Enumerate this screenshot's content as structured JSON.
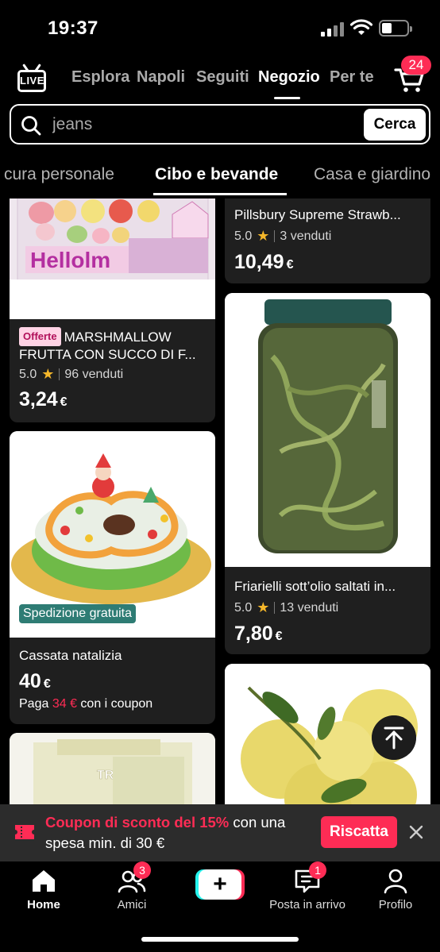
{
  "status_bar": {
    "time": "19:37"
  },
  "top_nav": {
    "live_label": "LIVE",
    "tabs": [
      {
        "label": "Esplora"
      },
      {
        "label": "Napoli"
      },
      {
        "label": "Seguiti"
      },
      {
        "label": "Negozio",
        "active": true
      },
      {
        "label": "Per te"
      }
    ],
    "cart_count": "24"
  },
  "search": {
    "value": "jeans",
    "button": "Cerca"
  },
  "categories": [
    {
      "label": "cura personale"
    },
    {
      "label": "Cibo e bevande",
      "active": true
    },
    {
      "label": "Casa e giardino"
    }
  ],
  "products": [
    {
      "badge": "Offerte",
      "title": "MARSHMALLOW FRUTTA CON SUCCO DI F...",
      "rating": "5.0",
      "sold": "96 venduti",
      "price": "3,24",
      "currency": "€",
      "image_text": "Hellolm"
    },
    {
      "title": "Pillsbury Supreme Strawb...",
      "rating": "5.0",
      "sold": "3 venduti",
      "price": "10,49",
      "currency": "€"
    },
    {
      "title": "Friarielli sott’olio saltati in...",
      "rating": "5.0",
      "sold": "13 venduti",
      "price": "7,80",
      "currency": "€"
    },
    {
      "shipping_tag": "Spedizione gratuita",
      "title": "Cassata natalizia",
      "price": "40",
      "currency": "€",
      "coupon_prefix": "Paga",
      "coupon_price": "34 €",
      "coupon_suffix": "con i coupon"
    },
    {
      "image_text": "TROIANO"
    },
    {
      "image_text": ""
    }
  ],
  "coupon_banner": {
    "highlight": "Coupon di sconto del 15%",
    "text": "con una spesa min. di 30 €",
    "button": "Riscatta"
  },
  "bottom_nav": [
    {
      "label": "Home",
      "active": true
    },
    {
      "label": "Amici",
      "badge": "3"
    },
    {
      "label": "Posta in arrivo",
      "badge": "1"
    },
    {
      "label": "Profilo"
    }
  ],
  "colors": {
    "accent": "#fe2c55",
    "cyan": "#25f4ee",
    "star": "#f5b72a",
    "shipping": "#2e7c74"
  }
}
